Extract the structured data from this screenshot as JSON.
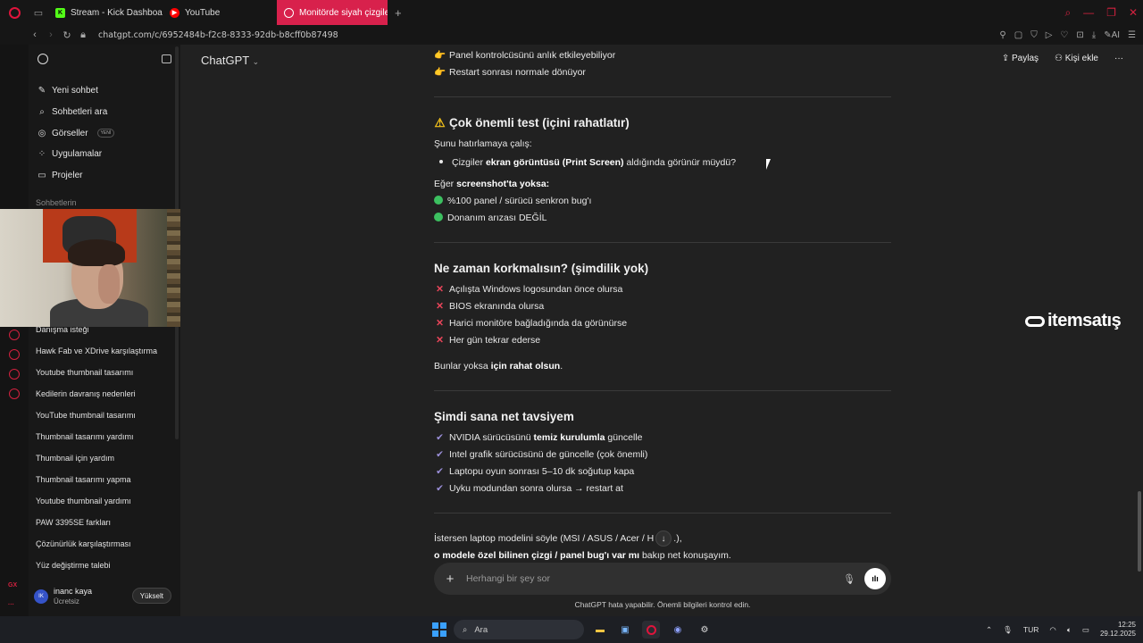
{
  "browser": {
    "tabs": [
      {
        "label": "Stream - Kick Dashboard"
      },
      {
        "label": "YouTube"
      },
      {
        "label": "Monitörde siyah çizgiler"
      }
    ],
    "url": "chatgpt.com/c/6952484b-f2c8-8333-92db-b8cff0b87498",
    "ai_label": "AI"
  },
  "sidebar": {
    "menu": [
      {
        "label": "Yeni sohbet",
        "icon": "pencil-icon"
      },
      {
        "label": "Sohbetleri ara",
        "icon": "search-icon"
      },
      {
        "label": "Görseller",
        "icon": "image-icon",
        "badge": "YENİ"
      },
      {
        "label": "Uygulamalar",
        "icon": "apps-icon"
      },
      {
        "label": "Projeler",
        "icon": "folder-icon"
      }
    ],
    "section_title": "Sohbetlerin",
    "history": [
      "Danışma isteği",
      "Hawk Fab ve XDrive karşılaştırma",
      "Youtube thumbnail tasarımı",
      "Kedilerin davranış nedenleri",
      "YouTube thumbnail tasarımı",
      "Thumbnail tasarımı yardımı",
      "Thumbnail için yardım",
      "Thumbnail tasarımı yapma",
      "Youtube thumbnail yardımı",
      "PAW 3395SE farkları",
      "Çözünürlük karşılaştırması",
      "Yüz değiştirme talebi"
    ],
    "user": {
      "initials": "IK",
      "name": "inanc kaya",
      "plan": "Ücretsiz",
      "upgrade": "Yükselt"
    }
  },
  "header": {
    "title": "ChatGPT",
    "share": "Paylaş",
    "add_person": "Kişi ekle"
  },
  "message": {
    "intro_lines": [
      "Panel kontrolcüsünü anlık etkileyebiliyor",
      "Restart sonrası normale dönüyor"
    ],
    "s1_title": "Çok önemli test (içini rahatlatır)",
    "s1_ask": "Şunu hatırlamaya çalış:",
    "s1_bullet_pre": "Çizgiler ",
    "s1_bullet_bold": "ekran görüntüsü (Print Screen)",
    "s1_bullet_post": " aldığında görünür müydü?",
    "s1_if_pre": "Eğer ",
    "s1_if_bold": "screenshot'ta yoksa:",
    "s1_points": [
      "%100 panel / sürücü senkron bug'ı",
      "Donanım arızası DEĞİL"
    ],
    "s2_title": "Ne zaman korkmalısın? (şimdilik yok)",
    "s2_points": [
      "Açılışta Windows logosundan önce olursa",
      "BIOS ekranında olursa",
      "Harici monitöre bağladığında da görünürse",
      "Her gün tekrar ederse"
    ],
    "s2_foot_pre": "Bunlar yoksa ",
    "s2_foot_bold": "için rahat olsun",
    "s2_foot_post": ".",
    "s3_title": "Şimdi sana net tavsiyem",
    "s3_p1_pre": "NVIDIA sürücüsünü ",
    "s3_p1_bold": "temiz kurulumla",
    "s3_p1_post": " güncelle",
    "s3_points": [
      "Intel grafik sürücüsünü de güncelle (çok önemli)",
      "Laptopu oyun sonrası 5–10 dk soğutup kapa",
      "Uyku modundan sonra olursa → restart at"
    ],
    "closing_1": "İstersen laptop modelini söyle (MSI / ASUS / Acer / H",
    "closing_1_end": ".),",
    "closing_2_bold": "o modele özel bilinen çizgi / panel bug'ı var mı",
    "closing_2_post": " bakıp net konuşayım."
  },
  "composer": {
    "placeholder": "Herhangi bir şey sor",
    "disclaimer": "ChatGPT hata yapabilir. Önemli bilgileri kontrol edin."
  },
  "watermark": "itemsatış",
  "taskbar": {
    "search": "Ara",
    "lang": "TUR",
    "time": "12:25",
    "date": "29.12.2025"
  }
}
